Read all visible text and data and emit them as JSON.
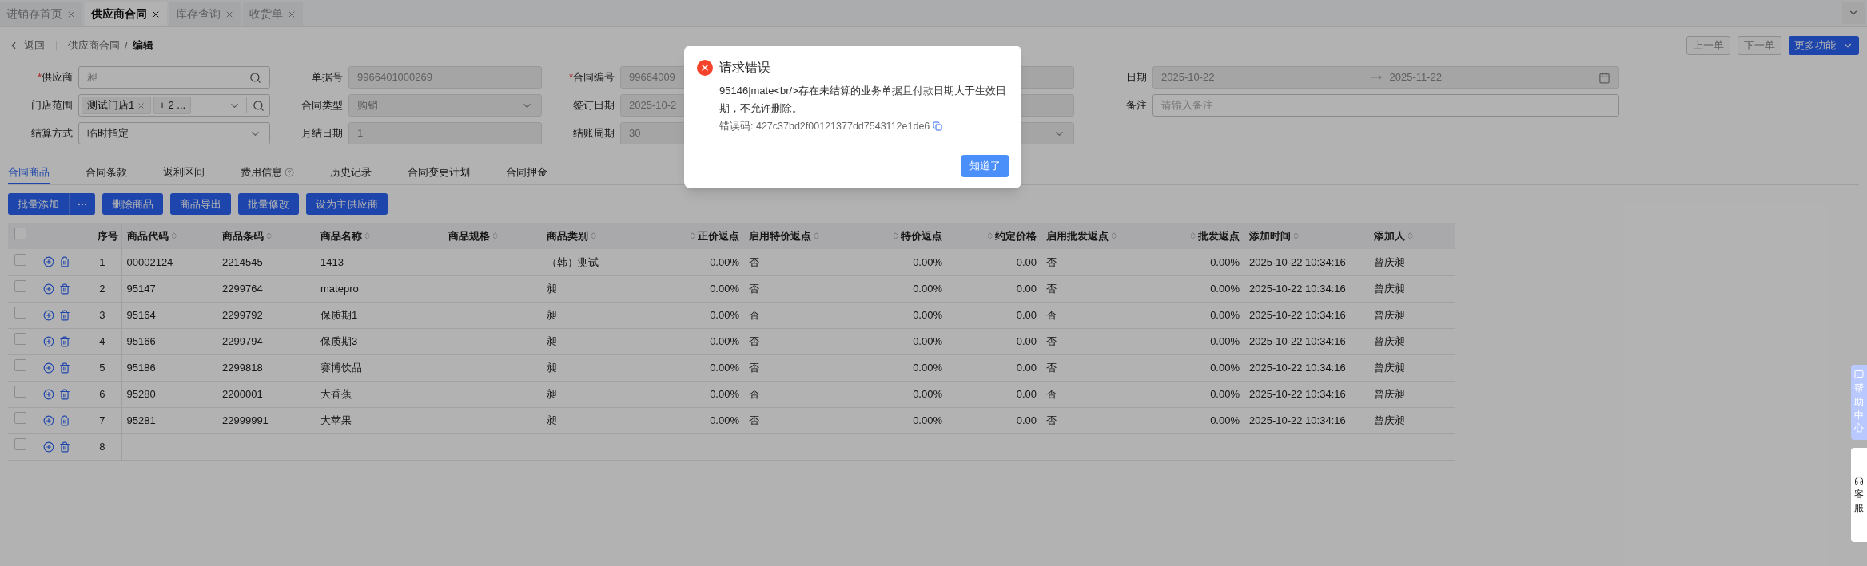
{
  "tabs": [
    {
      "label": "进销存首页",
      "selected": false
    },
    {
      "label": "供应商合同",
      "selected": true
    },
    {
      "label": "库存查询",
      "selected": false
    },
    {
      "label": "收货单",
      "selected": false
    }
  ],
  "breadcrumb": {
    "back": "返回",
    "separator": "/",
    "items": [
      "供应商合同",
      "编辑"
    ]
  },
  "nav_buttons": [
    {
      "label": "上一单",
      "disabled": true
    },
    {
      "label": "下一单",
      "disabled": true
    }
  ],
  "more_button": "更多功能",
  "form": {
    "rows": [
      [
        {
          "label": "供应商",
          "mark": "*",
          "kind": "search",
          "value": "昶",
          "disabled": false
        },
        {
          "label": "单据号",
          "kind": "text",
          "value": "9966401000269",
          "disabled": true
        },
        {
          "label": "合同编号",
          "mark": "*",
          "kind": "text",
          "value": "99664009",
          "disabled": true
        },
        {
          "label": "日期",
          "kind": "daterange",
          "start": "2025-10-22",
          "end": "2025-11-22",
          "disabled": true
        }
      ],
      [
        {
          "label": "门店范围",
          "kind": "tags",
          "tags": [
            "测试门店1",
            "+ 2 ..."
          ],
          "disabled": false
        },
        {
          "label": "合同类型",
          "kind": "select",
          "value": "购销",
          "disabled": true
        },
        {
          "label": "签订日期",
          "kind": "text",
          "value": "2025-10-2",
          "disabled": true
        },
        {
          "label": "备注",
          "kind": "text",
          "placeholder": "请输入备注",
          "disabled": false
        }
      ],
      [
        {
          "label": "结算方式",
          "kind": "select",
          "value": "临时指定",
          "disabled": false
        },
        {
          "label": "月结日期",
          "kind": "text",
          "value": "1",
          "disabled": true
        },
        {
          "label": "结账周期",
          "kind": "select",
          "value": "30",
          "disabled": true
        }
      ]
    ]
  },
  "section_tabs": [
    {
      "label": "合同商品",
      "selected": true,
      "help": false
    },
    {
      "label": "合同条款",
      "selected": false,
      "help": false
    },
    {
      "label": "返利区间",
      "selected": false,
      "help": false
    },
    {
      "label": "费用信息",
      "selected": false,
      "help": true
    },
    {
      "label": "历史记录",
      "selected": false,
      "help": false
    },
    {
      "label": "合同变更计划",
      "selected": false,
      "help": false
    },
    {
      "label": "合同押金",
      "selected": false,
      "help": false
    }
  ],
  "actions": [
    {
      "label": "批量添加",
      "more": true
    },
    {
      "label": "删除商品",
      "more": false
    },
    {
      "label": "商品导出",
      "more": false
    },
    {
      "label": "批量修改",
      "more": false
    },
    {
      "label": "设为主供应商",
      "more": false
    }
  ],
  "table": {
    "select_all": {
      "checked": false
    },
    "index_label": "序号",
    "columns": [
      {
        "label": "商品代码",
        "numeric": false
      },
      {
        "label": "商品条码",
        "numeric": false
      },
      {
        "label": "商品名称",
        "numeric": false
      },
      {
        "label": "商品规格",
        "numeric": false
      },
      {
        "label": "商品类别",
        "numeric": false
      },
      {
        "label": "正价返点",
        "numeric": true
      },
      {
        "label": "启用特价返点",
        "numeric": false
      },
      {
        "label": "特价返点",
        "numeric": true
      },
      {
        "label": "约定价格",
        "numeric": true
      },
      {
        "label": "启用批发返点",
        "numeric": false
      },
      {
        "label": "批发返点",
        "numeric": true
      },
      {
        "label": "添加时间",
        "numeric": false
      },
      {
        "label": "添加人",
        "numeric": false
      }
    ],
    "rows": [
      {
        "index": "1",
        "checked": false,
        "cells": [
          "00002124",
          "2214545",
          "1413",
          "",
          "（韩）测试",
          "0.00%",
          "否",
          "0.00%",
          "0.00",
          "否",
          "0.00%",
          "2025-10-22 10:34:16",
          "曾庆昶"
        ]
      },
      {
        "index": "2",
        "checked": false,
        "cells": [
          "95147",
          "2299764",
          "matepro",
          "",
          "昶",
          "0.00%",
          "否",
          "0.00%",
          "0.00",
          "否",
          "0.00%",
          "2025-10-22 10:34:16",
          "曾庆昶"
        ]
      },
      {
        "index": "3",
        "checked": false,
        "cells": [
          "95164",
          "2299792",
          "保质期1",
          "",
          "昶",
          "0.00%",
          "否",
          "0.00%",
          "0.00",
          "否",
          "0.00%",
          "2025-10-22 10:34:16",
          "曾庆昶"
        ]
      },
      {
        "index": "4",
        "checked": false,
        "cells": [
          "95166",
          "2299794",
          "保质期3",
          "",
          "昶",
          "0.00%",
          "否",
          "0.00%",
          "0.00",
          "否",
          "0.00%",
          "2025-10-22 10:34:16",
          "曾庆昶"
        ]
      },
      {
        "index": "5",
        "checked": false,
        "cells": [
          "95186",
          "2299818",
          "赛博饮品",
          "",
          "昶",
          "0.00%",
          "否",
          "0.00%",
          "0.00",
          "否",
          "0.00%",
          "2025-10-22 10:34:16",
          "曾庆昶"
        ]
      },
      {
        "index": "6",
        "checked": false,
        "cells": [
          "95280",
          "2200001",
          "大香蕉",
          "",
          "昶",
          "0.00%",
          "否",
          "0.00%",
          "0.00",
          "否",
          "0.00%",
          "2025-10-22 10:34:16",
          "曾庆昶"
        ]
      },
      {
        "index": "7",
        "checked": false,
        "cells": [
          "95281",
          "22999991",
          "大苹果",
          "",
          "昶",
          "0.00%",
          "否",
          "0.00%",
          "0.00",
          "否",
          "0.00%",
          "2025-10-22 10:34:16",
          "曾庆昶"
        ]
      },
      {
        "index": "8",
        "checked": false,
        "cells": []
      }
    ]
  },
  "side_widgets": [
    {
      "kind": "help",
      "label": "帮助中心"
    },
    {
      "kind": "service",
      "label": "客服"
    }
  ],
  "modal": {
    "title": "请求错误",
    "message": "95146|mate<br/>存在未结算的业务单据且付款日期大于生效日期，不允许删除。",
    "error_code": "错误码: 427c37bd2f00121377dd7543112e1de6",
    "button": "知道了"
  }
}
